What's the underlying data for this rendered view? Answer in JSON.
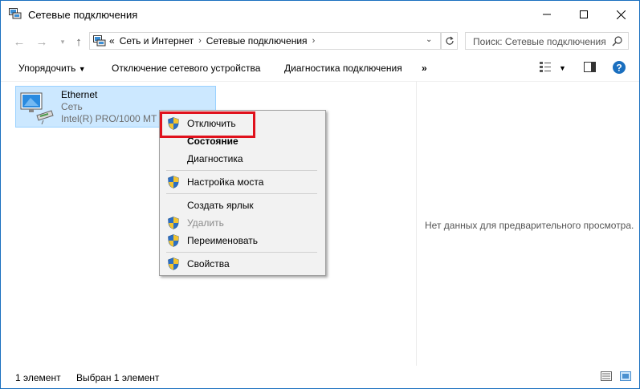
{
  "window": {
    "title": "Сетевые подключения",
    "controls": [
      "minimize",
      "maximize",
      "close"
    ]
  },
  "address": {
    "breadcrumb_lead": "«",
    "crumbs": [
      "Сеть и Интернет",
      "Сетевые подключения"
    ],
    "search_placeholder": "Поиск: Сетевые подключения"
  },
  "toolbar": {
    "organize": "Упорядочить",
    "disable_device": "Отключение сетевого устройства",
    "diagnose": "Диагностика подключения",
    "more": "»"
  },
  "connection": {
    "name": "Ethernet",
    "network": "Сеть",
    "adapter": "Intel(R) PRO/1000 MT Desktop Adapter"
  },
  "context_menu": {
    "items": [
      {
        "label": "Отключить",
        "shield": true
      },
      {
        "label": "Состояние",
        "bold": true
      },
      {
        "label": "Диагностика"
      },
      {
        "label": "Настройка моста",
        "shield": true
      },
      {
        "label": "Создать ярлык"
      },
      {
        "label": "Удалить",
        "shield": true,
        "disabled": true
      },
      {
        "label": "Переименовать",
        "shield": true
      },
      {
        "label": "Свойства",
        "shield": true
      }
    ]
  },
  "preview": {
    "empty_text": "Нет данных для предварительного просмотра."
  },
  "status": {
    "count": "1 элемент",
    "selected": "Выбран 1 элемент"
  },
  "colors": {
    "selection_bg": "#cce8ff",
    "highlight": "#e0111c",
    "help": "#1a6fbf"
  }
}
